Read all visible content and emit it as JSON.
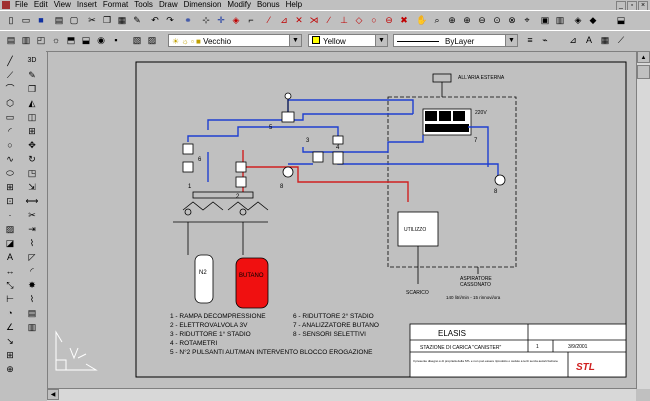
{
  "menu": {
    "items": [
      "File",
      "Edit",
      "View",
      "Insert",
      "Format",
      "Tools",
      "Draw",
      "Dimension",
      "Modify",
      "Bonus",
      "Help"
    ]
  },
  "toolbar": {
    "layer_value": "Vecchio",
    "color_value": "Yellow",
    "linetype_value": "ByLayer"
  },
  "drawing": {
    "vent_label": "ALL'ARIA ESTERNA",
    "voltage_label": "220V",
    "utilizzo_label": "UTILIZZO",
    "scarico_label": "SCARICO",
    "aspiratore_label": "ASPIRATORE\nCASSONATO",
    "aspiratore_sub": "140 litri/min - 15 rinnovi/ora",
    "n2_label": "N2",
    "butano_label": "BUTANO",
    "numbers": [
      "1",
      "2",
      "3",
      "4",
      "5",
      "6",
      "7",
      "8"
    ],
    "legend_left": [
      "1 - RAMPA DECOMPRESSIONE",
      "2 - ELETTROVALVOLA 3V",
      "3 - RIDUTTORE 1° STADIO",
      "4 - ROTAMETRI",
      "5 - N°2 PULSANTI AUT/MAN INTERVENTO BLOCCO EROGAZIONE"
    ],
    "legend_right": [
      "6 - RIDUTTORE 2° STADIO",
      "7 - ANALIZZATORE BUTANO",
      "8 - SENSORI SELETTIVI"
    ],
    "title_block": {
      "company": "ELASIS",
      "title": "STAZIONE DI CARICA \"CANISTER\"",
      "sheet": "1",
      "date": "3/9/2001",
      "logo": "STL",
      "notes": "Il presente disegno è di proprietà della STL e non può essere riprodotto o ceduto a terzi senza autorizzazione"
    }
  },
  "colors": {
    "blue_line": "#1f3fd0",
    "red_line": "#d02020",
    "butano": "#f01010"
  }
}
